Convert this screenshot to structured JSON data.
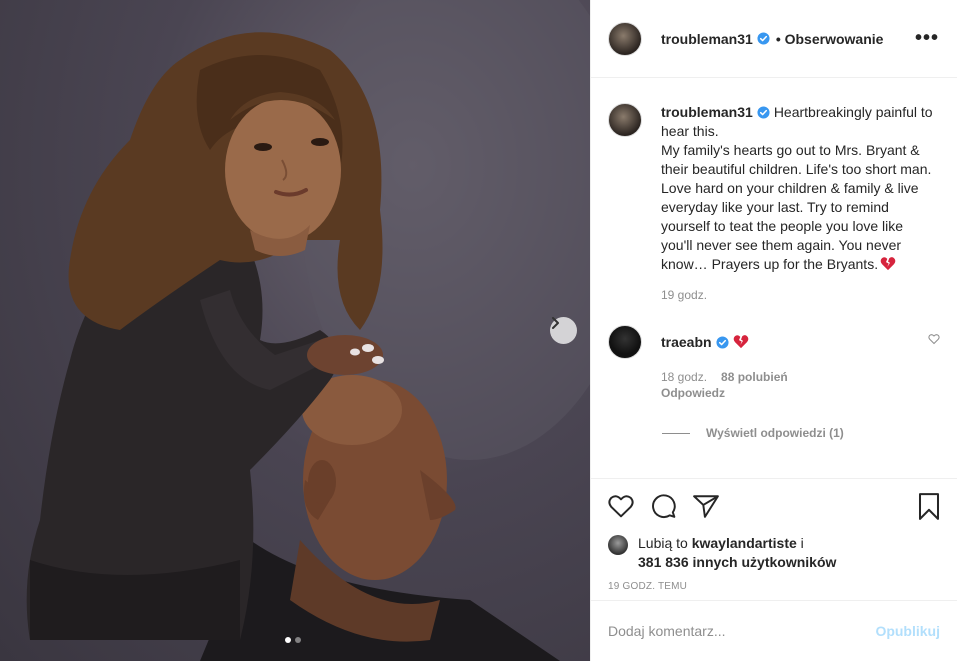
{
  "post": {
    "username": "troubleman31",
    "follow_status": "Obserwowanie",
    "more_label": "•••",
    "caption": "Heartbreakingly painful to hear this.\nMy family's hearts go out to Mrs. Bryant & their beautiful children. Life's too short man. Love hard on your children & family & live everyday like your last. Try to remind yourself to teat the people you love like you'll never see them again. You never know… Prayers up for the Bryants.",
    "caption_time": "19 godz."
  },
  "comment": {
    "username": "traeabn",
    "time": "18 godz.",
    "likes": "88 polubień",
    "reply_label": "Odpowiedz",
    "view_replies": "Wyświetl odpowiedzi (1)"
  },
  "likes": {
    "prefix": "Lubią to",
    "user": "kwaylandartiste",
    "suffix": "i",
    "others": "381 836 innych użytkowników"
  },
  "timestamp": "19 GODZ. TEMU",
  "add_comment": {
    "placeholder": "Dodaj komentarz...",
    "publish_label": "Opublikuj"
  },
  "carousel": {
    "total": 2,
    "active": 1
  },
  "colors": {
    "verified": "#3897f0",
    "heart": "#d6243d",
    "publish": "#b2dffc"
  },
  "icons": [
    "chevron-right-icon",
    "verified-badge-icon",
    "heart-icon",
    "comment-icon",
    "share-icon",
    "bookmark-icon"
  ]
}
